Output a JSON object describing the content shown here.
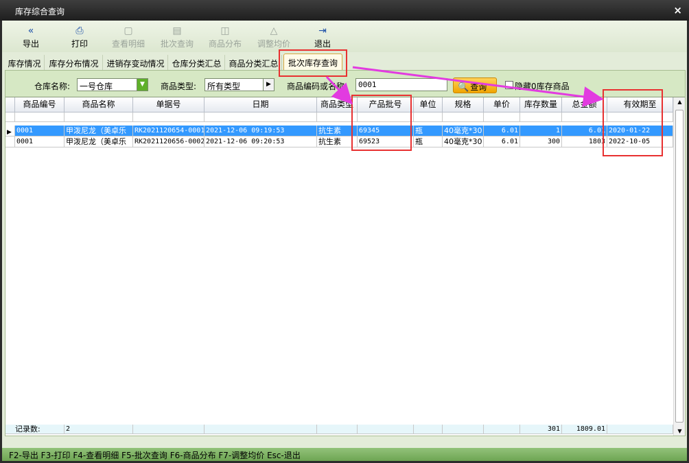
{
  "window": {
    "title": "库存综合查询",
    "close": "×"
  },
  "toolbar": [
    {
      "label": "导出",
      "icon": "«",
      "enabled": true
    },
    {
      "label": "打印",
      "icon": "⎙",
      "enabled": true
    },
    {
      "label": "查看明细",
      "icon": "▢",
      "enabled": false
    },
    {
      "label": "批次查询",
      "icon": "▤",
      "enabled": false
    },
    {
      "label": "商品分布",
      "icon": "◫",
      "enabled": false
    },
    {
      "label": "调整均价",
      "icon": "△",
      "enabled": false
    },
    {
      "label": "退出",
      "icon": "⇥",
      "enabled": true
    }
  ],
  "tabs": [
    "库存情况",
    "库存分布情况",
    "进销存变动情况",
    "仓库分类汇总",
    "商品分类汇总",
    "批次库存查询"
  ],
  "active_tab": "批次库存查询",
  "filter": {
    "warehouse_label": "仓库名称:",
    "warehouse_value": "一号仓库",
    "type_label": "商品类型:",
    "type_value": "所有类型",
    "code_label": "商品编码或名称:",
    "code_value": "0001",
    "query_label": "查询",
    "hide_zero_label": "隐藏0库存商品"
  },
  "table": {
    "headers": [
      "商品编号",
      "商品名称",
      "单据号",
      "日期",
      "商品类型",
      "产品批号",
      "单位",
      "规格",
      "单价",
      "库存数量",
      "总金额",
      "有效期至"
    ],
    "rows": [
      [
        "0001",
        "甲泼尼龙（美卓乐",
        "RK2021120654-0001",
        "2021-12-06 09:19:53",
        "抗生素",
        "69345",
        "瓶",
        "40毫克*30",
        "6.01",
        "1",
        "6.01",
        "2020-01-22"
      ],
      [
        "0001",
        "甲泼尼龙（美卓乐",
        "RK2021120656-0002",
        "2021-12-06 09:20:53",
        "抗生素",
        "69523",
        "瓶",
        "40毫克*30",
        "6.01",
        "300",
        "1803",
        "2022-10-05"
      ]
    ],
    "selected_row": 0,
    "footer": {
      "label": "记录数:",
      "count": "2",
      "qty_total": "301",
      "amount_total": "1809.01"
    }
  },
  "statusbar": "F2-导出 F3-打印 F4-查看明细 F5-批次查询 F6-商品分布 F7-调整均价 Esc-退出"
}
